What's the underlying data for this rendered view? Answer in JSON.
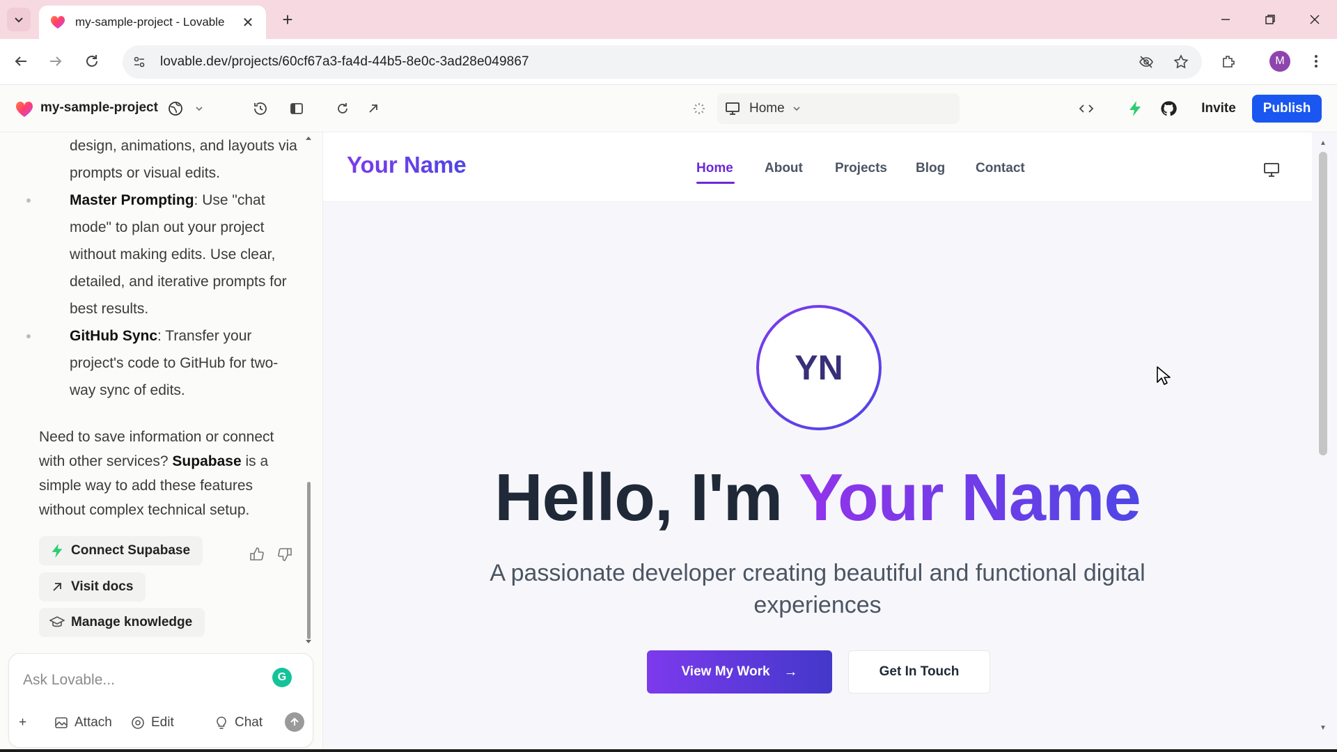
{
  "browser": {
    "tab_title": "my-sample-project - Lovable",
    "tab_close": "✕",
    "new_tab": "+",
    "url": "lovable.dev/projects/60cf67a3-fa4d-44b5-8e0c-3ad28e049867",
    "profile_initial": "M",
    "icons": [
      "tab-search-icon",
      "back-icon",
      "forward-icon",
      "reload-icon",
      "site-info-icon",
      "eye-off-icon",
      "star-icon",
      "extensions-icon",
      "menu-icon",
      "minimize-icon",
      "restore-icon",
      "close-icon"
    ]
  },
  "app_header": {
    "project_name": "my-sample-project",
    "route": "Home",
    "invite": "Invite",
    "publish": "Publish",
    "icons": [
      "globe-icon",
      "chevron-down-icon",
      "history-icon",
      "sidebar-toggle-icon",
      "refresh-icon",
      "open-external-icon",
      "loading-icon",
      "monitor-icon",
      "code-icon",
      "bolt-icon",
      "github-icon"
    ],
    "colors": {
      "publish": "#1a56f0",
      "brand": "#ff4d6d"
    }
  },
  "chat": {
    "bullets": [
      {
        "title": "",
        "text": "design, animations, and layouts via prompts or visual edits."
      },
      {
        "title": "Master Prompting",
        "text": ": Use \"chat mode\" to plan out your project without making edits. Use clear, detailed, and iterative prompts for best results."
      },
      {
        "title": "GitHub Sync",
        "text": ": Transfer your project's code to GitHub for two-way sync of edits."
      }
    ],
    "save_para": {
      "before": "Need to save information or connect with other services? ",
      "bold": "Supabase",
      "after": " is a simple way to add these features without complex technical setup."
    },
    "actions": {
      "connect_supabase": "Connect Supabase",
      "visit_docs": "Visit docs",
      "manage_knowledge": "Manage knowledge"
    },
    "input": {
      "placeholder": "Ask Lovable...",
      "attach": "Attach",
      "edit": "Edit",
      "chat": "Chat",
      "plus": "+"
    }
  },
  "preview": {
    "brand": "Your Name",
    "nav": [
      "Home",
      "About",
      "Projects",
      "Blog",
      "Contact"
    ],
    "active_nav": "Home",
    "avatar_initials": "YN",
    "hero_prefix": "Hello, I'm ",
    "hero_name": "Your Name",
    "subtitle": "A passionate developer creating beautiful and functional digital experiences",
    "cta_primary": "View My Work",
    "cta_primary_arrow": "→",
    "cta_secondary": "Get In Touch",
    "colors": {
      "accent_start": "#7c3aed",
      "accent_end": "#4f46e5"
    }
  }
}
